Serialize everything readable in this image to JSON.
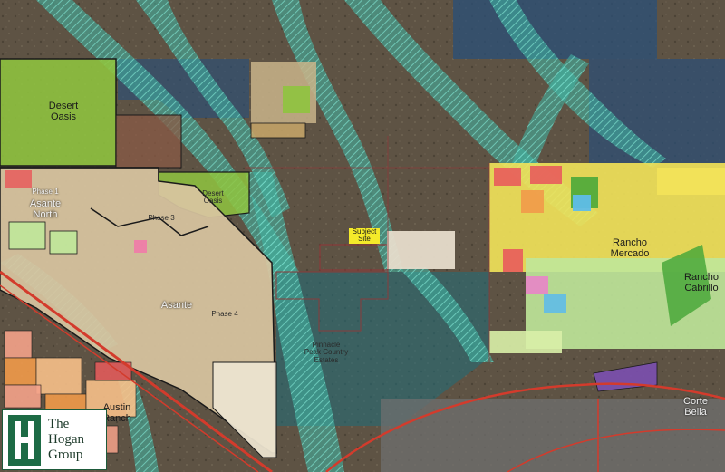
{
  "map": {
    "parcel_labels": [
      {
        "id": "desert-oasis",
        "text": "Desert\nOasis",
        "kind": "main"
      },
      {
        "id": "asante-north",
        "text": "Asante\nNorth",
        "kind": "light"
      },
      {
        "id": "phase-1",
        "text": "Phase 1",
        "kind": "light"
      },
      {
        "id": "desert-oasis-2",
        "text": "Desert\nOasis",
        "kind": "sub"
      },
      {
        "id": "phase-3",
        "text": "Phase 3",
        "kind": "sub"
      },
      {
        "id": "asante",
        "text": "Asante",
        "kind": "light"
      },
      {
        "id": "phase-4",
        "text": "Phase 4",
        "kind": "sub"
      },
      {
        "id": "subject-site",
        "text": "Subject\nSite",
        "kind": "subject"
      },
      {
        "id": "rancho-mercado",
        "text": "Rancho\nMercado",
        "kind": "main"
      },
      {
        "id": "rancho-cabrillo",
        "text": "Rancho\nCabrillo",
        "kind": "main"
      },
      {
        "id": "pinnacle-peak",
        "text": "Pinnacle\nPeak Country\nEstates",
        "kind": "sub"
      },
      {
        "id": "austin-ranch",
        "text": "Austin\nRanch",
        "kind": "main"
      },
      {
        "id": "corte-bella",
        "text": "Corte\nBella",
        "kind": "light"
      }
    ]
  },
  "logo": {
    "line1": "The",
    "line2": "Hogan",
    "line3": "Group"
  },
  "colors": {
    "terrain": "#5e5344",
    "floodplain": "#3fb8a6",
    "water_overlay": "#2a4f78",
    "parcel_green": "#8fc43f",
    "parcel_tan": "#d9c6a1",
    "parcel_yellow": "#f2e35a",
    "parcel_light_green": "#bfe79a",
    "parcel_red": "#e85c5c",
    "parcel_orange": "#f19a4a",
    "parcel_purple": "#7b4fb0",
    "road_red": "#d33b2c"
  }
}
